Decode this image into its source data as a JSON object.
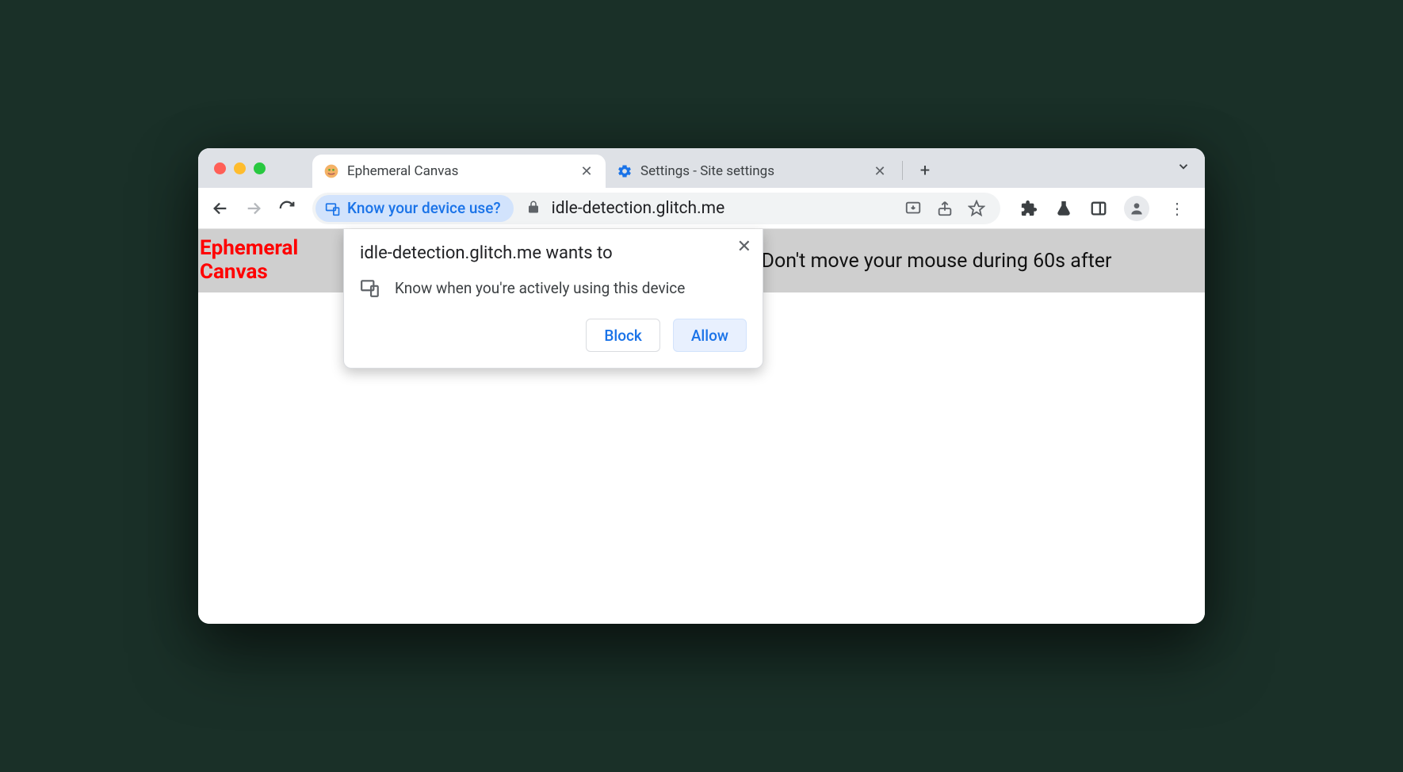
{
  "tabs": [
    {
      "title": "Ephemeral Canvas",
      "active": true
    },
    {
      "title": "Settings - Site settings",
      "active": false
    }
  ],
  "omnibox": {
    "chip_label": "Know your device use?",
    "url": "idle-detection.glitch.me"
  },
  "page": {
    "title_line1": "Ephemeral",
    "title_line2": "Canvas",
    "instruction": "(Don't move your mouse during 60s after"
  },
  "permission": {
    "title": "idle-detection.glitch.me wants to",
    "item": "Know when you're actively using this device",
    "block": "Block",
    "allow": "Allow"
  }
}
